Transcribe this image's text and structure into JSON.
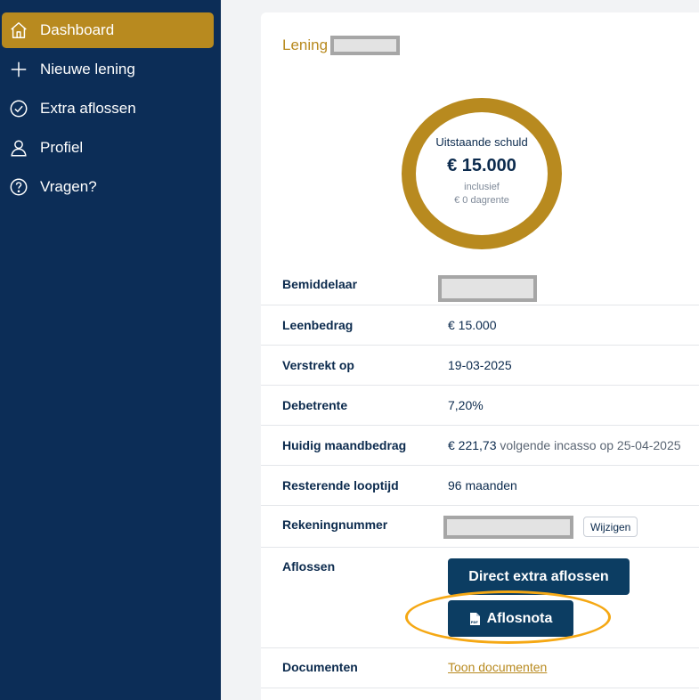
{
  "sidebar": {
    "items": [
      {
        "label": "Dashboard",
        "icon": "home-icon",
        "active": true
      },
      {
        "label": "Nieuwe lening",
        "icon": "plus-icon"
      },
      {
        "label": "Extra aflossen",
        "icon": "check-circle-icon"
      },
      {
        "label": "Profiel",
        "icon": "user-icon"
      },
      {
        "label": "Vragen?",
        "icon": "question-circle-icon"
      }
    ]
  },
  "loan": {
    "title": "Lening",
    "donut": {
      "label": "Uitstaande schuld",
      "amount": "€ 15.000",
      "sub1": "inclusief",
      "sub2": "€ 0 dagrente"
    },
    "rows": {
      "bemiddelaar_label": "Bemiddelaar",
      "leenbedrag_label": "Leenbedrag",
      "leenbedrag_value": "€ 15.000",
      "verstrekt_label": "Verstrekt op",
      "verstrekt_value": "19-03-2025",
      "debetrente_label": "Debetrente",
      "debetrente_value": "7,20%",
      "maandbedrag_label": "Huidig maandbedrag",
      "maandbedrag_value": "€ 221,73",
      "maandbedrag_note": " volgende incasso op 25-04-2025",
      "looptijd_label": "Resterende looptijd",
      "looptijd_value": "96 maanden",
      "rekening_label": "Rekeningnummer",
      "wijzigen_label": "Wijzigen",
      "aflossen_label": "Aflossen",
      "direct_button": "Direct extra aflossen",
      "aflosnota_button": "Aflosnota",
      "documenten_label": "Documenten",
      "documenten_link": "Toon documenten"
    }
  },
  "colors": {
    "sidebar_bg": "#0c2d57",
    "accent_gold": "#b88a1f",
    "button_bg": "#0c3d62",
    "highlight_orange": "#f5a814"
  }
}
